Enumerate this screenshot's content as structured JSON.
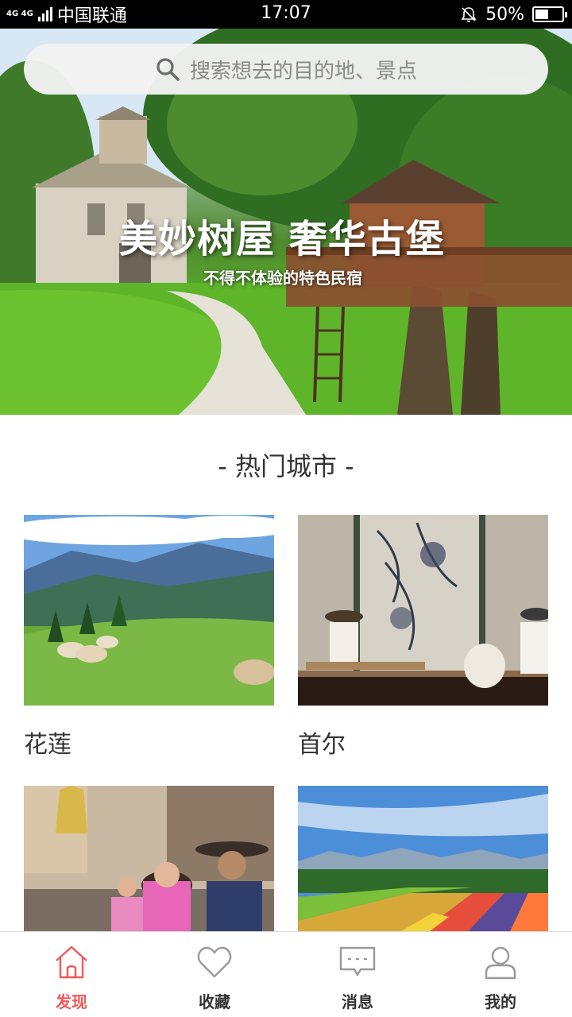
{
  "status_bar": {
    "network_top": "4G 4G",
    "carrier": "中国联通",
    "time": "17:07",
    "battery_percent": "50%",
    "battery_level": 0.5
  },
  "search": {
    "placeholder": "搜索想去的目的地、景点",
    "icon": "search-icon"
  },
  "banner": {
    "title": "美妙树屋 奢华古堡",
    "subtitle": "不得不体验的特色民宿"
  },
  "section": {
    "title": "- 热门城市 -"
  },
  "cities": [
    {
      "name": "花莲"
    },
    {
      "name": "首尔"
    },
    {
      "name": ""
    },
    {
      "name": ""
    }
  ],
  "tabs": [
    {
      "label": "发现",
      "icon": "home-icon",
      "active": true
    },
    {
      "label": "收藏",
      "icon": "heart-icon",
      "active": false
    },
    {
      "label": "消息",
      "icon": "message-icon",
      "active": false
    },
    {
      "label": "我的",
      "icon": "user-icon",
      "active": false
    }
  ],
  "colors": {
    "accent": "#f05a5a",
    "tab_inactive": "#999999"
  }
}
